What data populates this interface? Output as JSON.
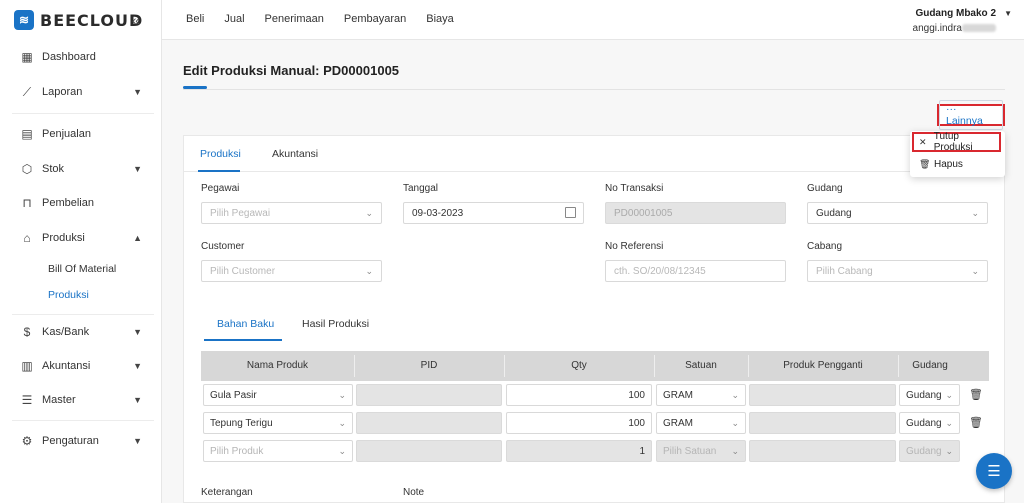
{
  "app": {
    "logo_text": "BEECLOUD"
  },
  "sidebar": {
    "items": [
      {
        "label": "Dashboard"
      },
      {
        "label": "Laporan"
      },
      {
        "label": "Penjualan"
      },
      {
        "label": "Stok"
      },
      {
        "label": "Pembelian"
      },
      {
        "label": "Produksi"
      },
      {
        "label": "Kas/Bank"
      },
      {
        "label": "Akuntansi"
      },
      {
        "label": "Master"
      },
      {
        "label": "Pengaturan"
      }
    ],
    "sub_items": [
      {
        "label": "Bill Of Material"
      },
      {
        "label": "Produksi"
      }
    ]
  },
  "topbar": {
    "nav": [
      "Beli",
      "Jual",
      "Penerimaan",
      "Pembayaran",
      "Biaya"
    ],
    "company": "Gudang Mbako 2",
    "user": "anggi.indra"
  },
  "page": {
    "title": "Edit Produksi Manual: PD00001005"
  },
  "more": {
    "label": "··· Lainnya",
    "menu": [
      {
        "label": "Tutup Produksi"
      },
      {
        "label": "Hapus"
      }
    ]
  },
  "tabs": [
    "Produksi",
    "Akuntansi"
  ],
  "form": {
    "pegawai": {
      "label": "Pegawai",
      "placeholder": "Pilih Pegawai"
    },
    "tanggal": {
      "label": "Tanggal",
      "value": "09-03-2023"
    },
    "no_transaksi": {
      "label": "No Transaksi",
      "value": "PD00001005"
    },
    "gudang": {
      "label": "Gudang",
      "value": "Gudang"
    },
    "customer": {
      "label": "Customer",
      "placeholder": "Pilih Customer"
    },
    "no_referensi": {
      "label": "No Referensi",
      "placeholder": "cth. SO/20/08/12345"
    },
    "cabang": {
      "label": "Cabang",
      "placeholder": "Pilih Cabang"
    }
  },
  "subtabs": [
    "Bahan Baku",
    "Hasil Produksi"
  ],
  "table": {
    "headers": [
      "Nama Produk",
      "PID",
      "Qty",
      "Satuan",
      "Produk Pengganti",
      "Gudang"
    ],
    "rows": [
      {
        "produk": "Gula Pasir",
        "qty": "100",
        "satuan": "GRAM",
        "gudang": "Gudang"
      },
      {
        "produk": "Tepung Terigu",
        "qty": "100",
        "satuan": "GRAM",
        "gudang": "Gudang"
      },
      {
        "produk": "Pilih Produk",
        "qty": "1",
        "satuan": "Pilih Satuan",
        "gudang": "Gudang"
      }
    ]
  },
  "footer_labels": {
    "keterangan": "Keterangan",
    "note": "Note"
  },
  "colors": {
    "accent": "#1a73c6",
    "highlight": "#d9282f"
  }
}
